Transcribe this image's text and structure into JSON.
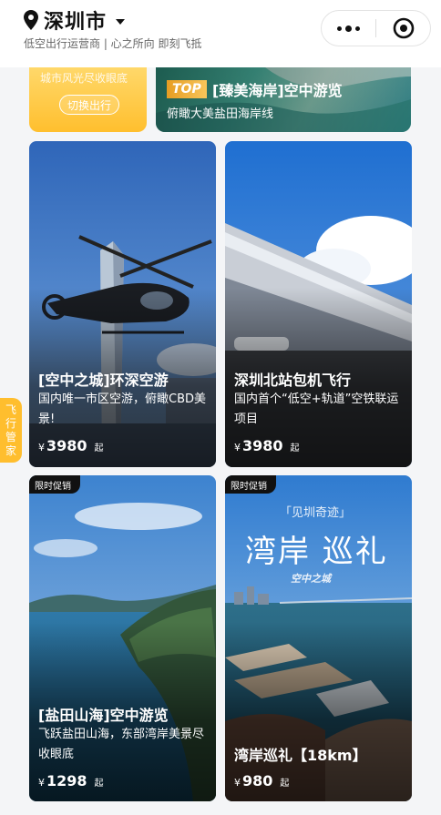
{
  "header": {
    "city": "深圳市",
    "slogan": "低空出行运营商 | 心之所向 即刻飞抵"
  },
  "banners": {
    "left": {
      "text": "城市风光尽收眼底",
      "button": "切换出行"
    },
    "right": {
      "badge": "TOP",
      "title": "[臻美海岸]空中游览",
      "subtitle": "俯瞰大美盐田海岸线"
    }
  },
  "cards": [
    {
      "title": "[空中之城]环深空游",
      "desc": "国内唯一市区空游，俯瞰CBD美景!",
      "yen": "¥",
      "price": "3980",
      "unit": "起"
    },
    {
      "title": "深圳北站包机飞行",
      "desc": "国内首个“低空+轨道”空铁联运项目",
      "yen": "¥",
      "price": "3980",
      "unit": "起"
    },
    {
      "promo": "限时促销",
      "title": "[盐田山海]空中游览",
      "desc": "飞跃盐田山海，东部湾岸美景尽收眼底",
      "yen": "¥",
      "price": "1298",
      "unit": "起"
    },
    {
      "promo": "限时促销",
      "title": "湾岸巡礼【18km】",
      "desc": "",
      "yen": "¥",
      "price": "980",
      "unit": "起",
      "poster_small": "「见圳奇迹」",
      "poster_title": "湾岸 巡礼",
      "poster_sub": "空中之城"
    }
  ],
  "side_tab": {
    "label": "飞行管家"
  },
  "icons": [
    "location-pin-icon",
    "caret-down-icon",
    "more-dots-icon",
    "target-circle-icon"
  ],
  "colors": {
    "accent_yellow": "#ffbe2e",
    "badge_gold": "#e79d23"
  }
}
